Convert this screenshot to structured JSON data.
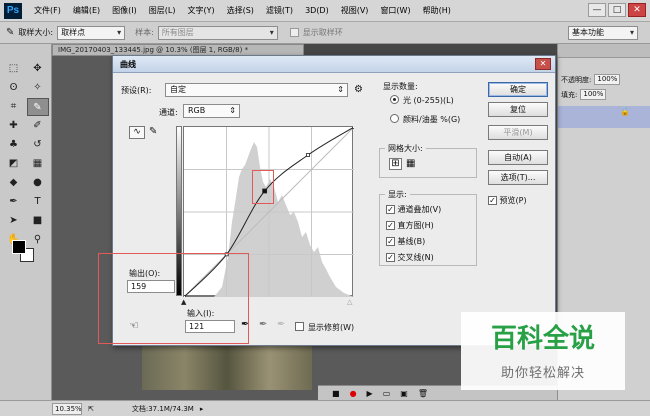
{
  "app": {
    "logo": "Ps",
    "menus": [
      "文件(F)",
      "编辑(E)",
      "图像(I)",
      "图层(L)",
      "文字(Y)",
      "选择(S)",
      "滤镜(T)",
      "3D(D)",
      "视图(V)",
      "窗口(W)",
      "帮助(H)"
    ],
    "window_controls": {
      "minimize": "—",
      "maximize": "□",
      "close": "✕"
    }
  },
  "options_bar": {
    "sample_size_label": "取样大小:",
    "sample_size_value": "取样点",
    "sample_label": "样本:",
    "sample_value": "所有图层",
    "show_ring_label": "显示取样环",
    "workspace": "基本功能"
  },
  "document": {
    "tab_title": "IMG_20170403_133445.jpg @ 10.3% (图层 1, RGB/8) *",
    "zoom": "10.35%",
    "doc_size": "文档:37.1M/74.3M"
  },
  "right_panel": {
    "opacity_label": "不透明度:",
    "opacity_value": "100%",
    "fill_label": "填充:",
    "fill_value": "100%",
    "lock_icon": "lock-icon"
  },
  "curves": {
    "title": "曲线",
    "close": "✕",
    "preset_label": "预设(R):",
    "preset_value": "自定",
    "channel_label": "通道:",
    "channel_value": "RGB",
    "output_label": "输出(O):",
    "output_value": "159",
    "input_label": "输入(I):",
    "input_value": "121",
    "show_clipping_label": "显示修剪(W)",
    "display_amount": {
      "title": "显示数量:",
      "light": "光 (0-255)(L)",
      "pigment": "颜料/油墨 %(G)",
      "selected": "light"
    },
    "grid_size": {
      "title": "网格大小:"
    },
    "display": {
      "title": "显示:",
      "channel_overlays": "通道叠加(V)",
      "histogram": "直方图(H)",
      "baseline": "基线(B)",
      "intersection": "交叉线(N)",
      "checked": [
        true,
        true,
        true,
        true
      ]
    },
    "buttons": {
      "ok": "确定",
      "reset": "复位",
      "smooth": "平滑(M)",
      "auto": "自动(A)",
      "options": "选项(T)...",
      "preview": "预览(P)"
    },
    "curve_points": [
      [
        0,
        0
      ],
      [
        64,
        64
      ],
      [
        121,
        159
      ],
      [
        186,
        213
      ],
      [
        255,
        255
      ]
    ],
    "selected_point": [
      121,
      159
    ]
  },
  "watermark": {
    "logo": "百科全说",
    "subtitle": "助你轻松解决"
  }
}
